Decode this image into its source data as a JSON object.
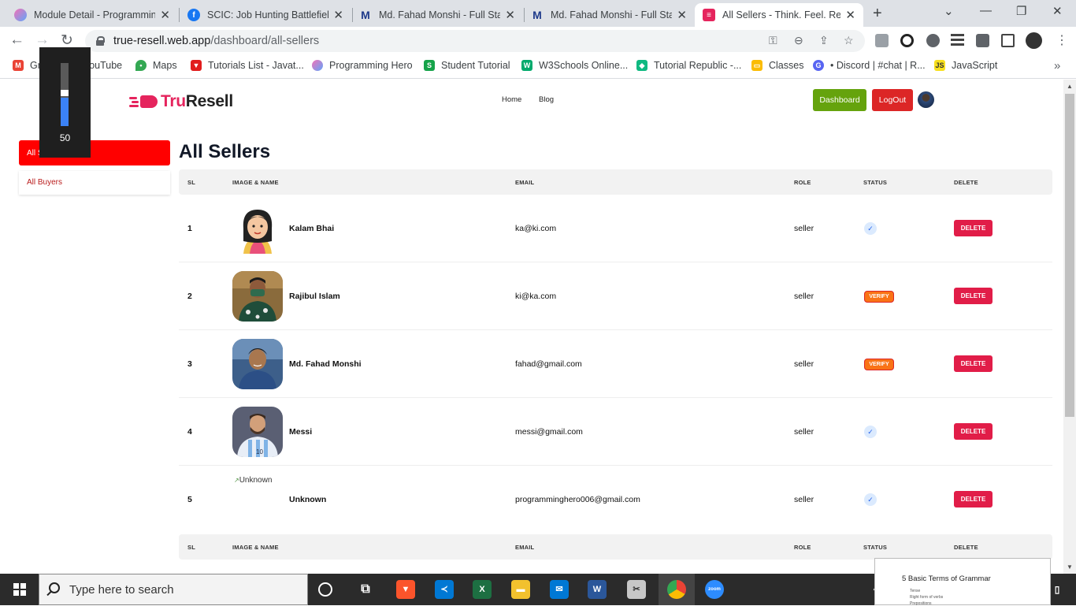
{
  "browser": {
    "tabs": [
      {
        "title": "Module Detail - Programming Hero",
        "icon": "programming-hero-icon",
        "color": "#7c3aed"
      },
      {
        "title": "SCIC: Job Hunting Battlefield",
        "icon": "facebook-icon",
        "color": "#1877f2"
      },
      {
        "title": "Md. Fahad Monshi - Full Stack",
        "icon": "gmail-m-icon",
        "color": "#1e3a8a"
      },
      {
        "title": "Md. Fahad Monshi - Full Stack",
        "icon": "gmail-m-icon",
        "color": "#1e3a8a"
      },
      {
        "title": "All Sellers - Think. Feel. Resell",
        "icon": "truresell-icon",
        "color": "#e5245d",
        "active": true
      }
    ],
    "url_host": "true-resell.web.app",
    "url_path": "/dashboard/all-sellers",
    "bookmarks": [
      {
        "label": "Gmail",
        "icon": "gmail-icon",
        "color": "#ea4335"
      },
      {
        "label": "YouTube",
        "icon": "youtube-icon",
        "color": "#ff0000"
      },
      {
        "label": "Maps",
        "icon": "maps-icon",
        "color": "#34a853"
      },
      {
        "label": "Tutorials List - Javat...",
        "icon": "javatpoint-icon",
        "color": "#e11d1d"
      },
      {
        "label": "Programming Hero",
        "icon": "programming-hero-icon",
        "color": "#7c3aed"
      },
      {
        "label": "Student Tutorial",
        "icon": "student-tutorial-icon",
        "color": "#16a34a"
      },
      {
        "label": "W3Schools Online...",
        "icon": "w3schools-icon",
        "color": "#04aa6d"
      },
      {
        "label": "Tutorial Republic -...",
        "icon": "tutorial-republic-icon",
        "color": "#10b981"
      },
      {
        "label": "Classes",
        "icon": "classes-icon",
        "color": "#fbbc04"
      },
      {
        "label": "• Discord | #chat | R...",
        "icon": "discord-icon",
        "color": "#5865f2"
      },
      {
        "label": "JavaScript",
        "icon": "javascript-icon",
        "color": "#f7df1e"
      }
    ]
  },
  "site": {
    "logo_part1": "Tru",
    "logo_part2": "Resell",
    "nav_home": "Home",
    "nav_blog": "Blog",
    "dashboard_btn": "Dashboard",
    "logout_btn": "LogOut"
  },
  "sidebar": {
    "active_item": "All Sellers",
    "item": "All Buyers"
  },
  "volume_overlay": {
    "value": "50",
    "level": 0.5
  },
  "page_title": "All Sellers",
  "table": {
    "headers": [
      "SL",
      "IMAGE & NAME",
      "EMAIL",
      "ROLE",
      "STATUS",
      "DELETE"
    ],
    "delete_label": "DELETE",
    "verify_label": "VERIFY",
    "check_glyph": "✓",
    "rows": [
      {
        "sl": "1",
        "name": "Kalam Bhai",
        "email": "ka@ki.com",
        "role": "seller",
        "status": "verified",
        "image": "cartoon-avatar"
      },
      {
        "sl": "2",
        "name": "Rajibul Islam",
        "email": "ki@ka.com",
        "role": "seller",
        "status": "unverified",
        "image": "photo"
      },
      {
        "sl": "3",
        "name": "Md. Fahad Monshi",
        "email": "fahad@gmail.com",
        "role": "seller",
        "status": "unverified",
        "image": "photo"
      },
      {
        "sl": "4",
        "name": "Messi",
        "email": "messi@gmail.com",
        "role": "seller",
        "status": "verified",
        "image": "photo"
      },
      {
        "sl": "5",
        "name": "Unknown",
        "email": "programminghero006@gmail.com",
        "role": "seller",
        "status": "verified",
        "image": "broken",
        "alt": "Unknown"
      }
    ]
  },
  "taskbar": {
    "search_placeholder": "Type here to search",
    "popup_title": "5 Basic Terms of Grammar",
    "popup_lines": [
      "Tense",
      "Right form of verbs",
      "Prepositions"
    ]
  }
}
